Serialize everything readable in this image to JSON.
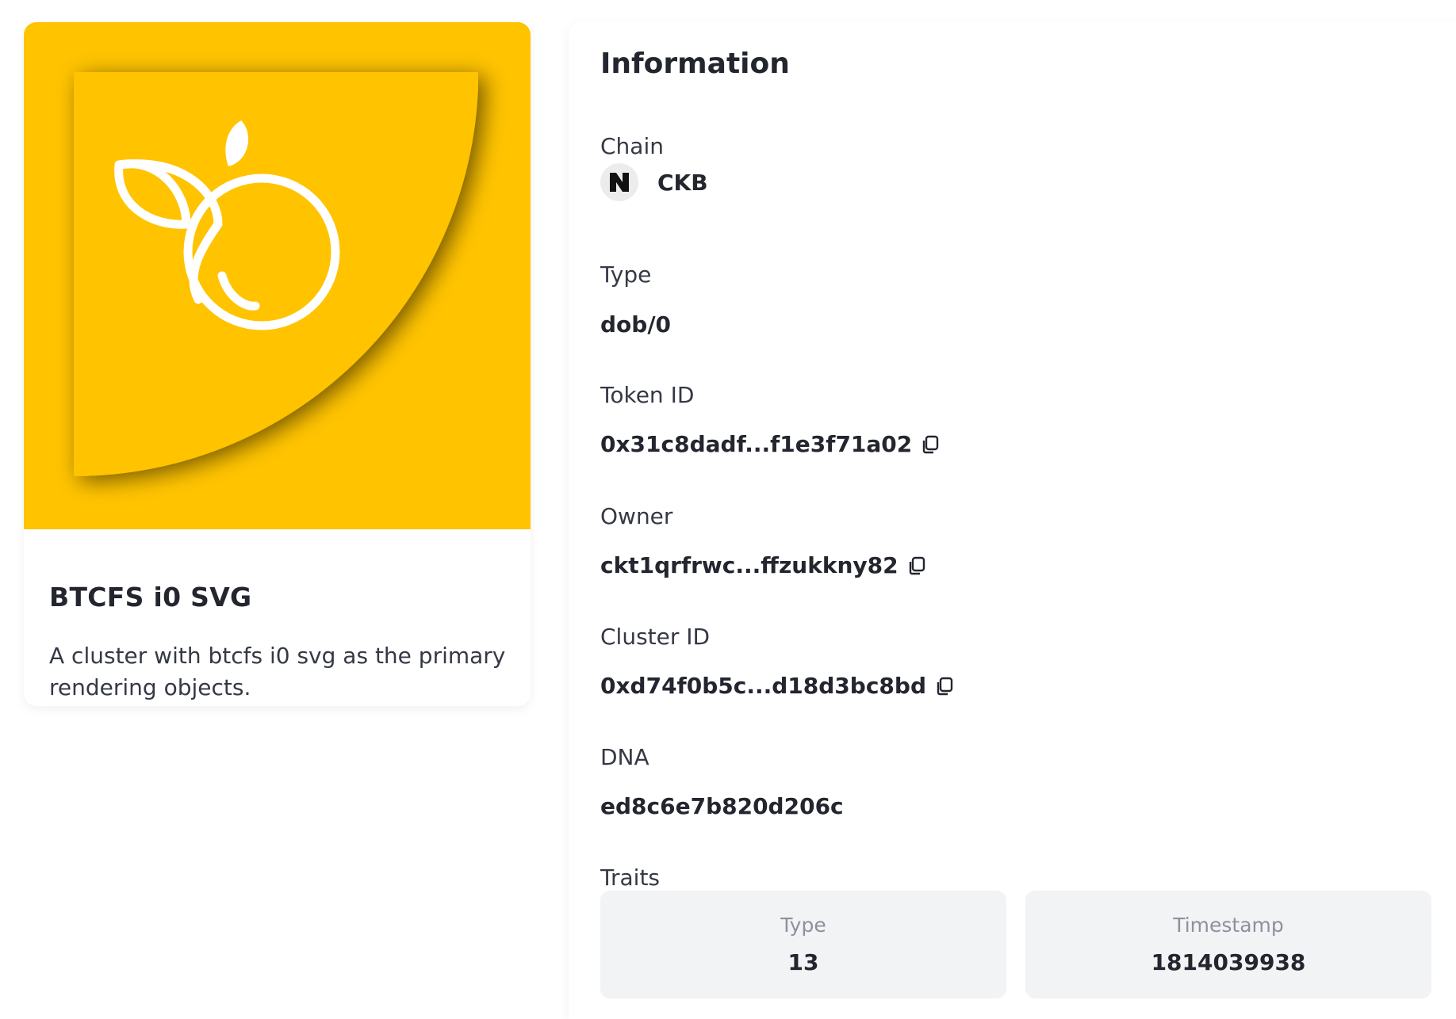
{
  "cluster": {
    "title": "BTCFS i0 SVG",
    "description": "A cluster with btcfs i0 svg as the primary rendering objects.",
    "image_colors": {
      "background": "#FFC300",
      "line": "#ffffff"
    }
  },
  "info": {
    "title": "Information",
    "chain": {
      "label": "Chain",
      "value": "CKB",
      "icon": "ckb-logo-icon"
    },
    "type": {
      "label": "Type",
      "value": "dob/0"
    },
    "token_id": {
      "label": "Token ID",
      "value": "0x31c8dadf...f1e3f71a02",
      "icon": "copy-icon"
    },
    "owner": {
      "label": "Owner",
      "value": "ckt1qrfrwc...ffzukkny82",
      "icon": "copy-icon"
    },
    "cluster_id": {
      "label": "Cluster ID",
      "value": "0xd74f0b5c...d18d3bc8bd",
      "icon": "copy-icon"
    },
    "dna": {
      "label": "DNA",
      "value": "ed8c6e7b820d206c"
    },
    "traits": {
      "label": "Traits",
      "items": [
        {
          "name": "Type",
          "value": "13"
        },
        {
          "name": "Timestamp",
          "value": "1814039938"
        }
      ]
    }
  }
}
